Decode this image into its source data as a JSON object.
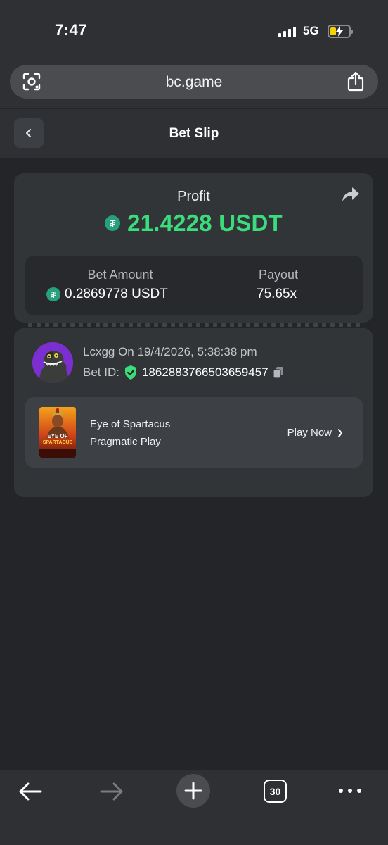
{
  "status_bar": {
    "time": "7:47",
    "network": "5G"
  },
  "browser": {
    "url": "bc.game",
    "open_tabs": "30"
  },
  "header": {
    "title": "Bet Slip"
  },
  "profit": {
    "label": "Profit",
    "amount": "21.4228 USDT",
    "currency_icon": "tether-icon",
    "color": "#3bdc7b"
  },
  "bet_amount": {
    "label": "Bet Amount",
    "value": "0.2869778 USDT"
  },
  "payout": {
    "label": "Payout",
    "value": "75.65x"
  },
  "bet_info": {
    "user_line": "Lcxgg On 19/4/2026, 5:38:38 pm",
    "bet_id_label": "Bet ID:",
    "bet_id": "1862883766503659457"
  },
  "game": {
    "name": "Eye of Spartacus",
    "provider": "Pragmatic Play",
    "play_label": "Play Now",
    "thumb_text_top": "EYE OF",
    "thumb_text_bottom": "SPARTACUS"
  }
}
